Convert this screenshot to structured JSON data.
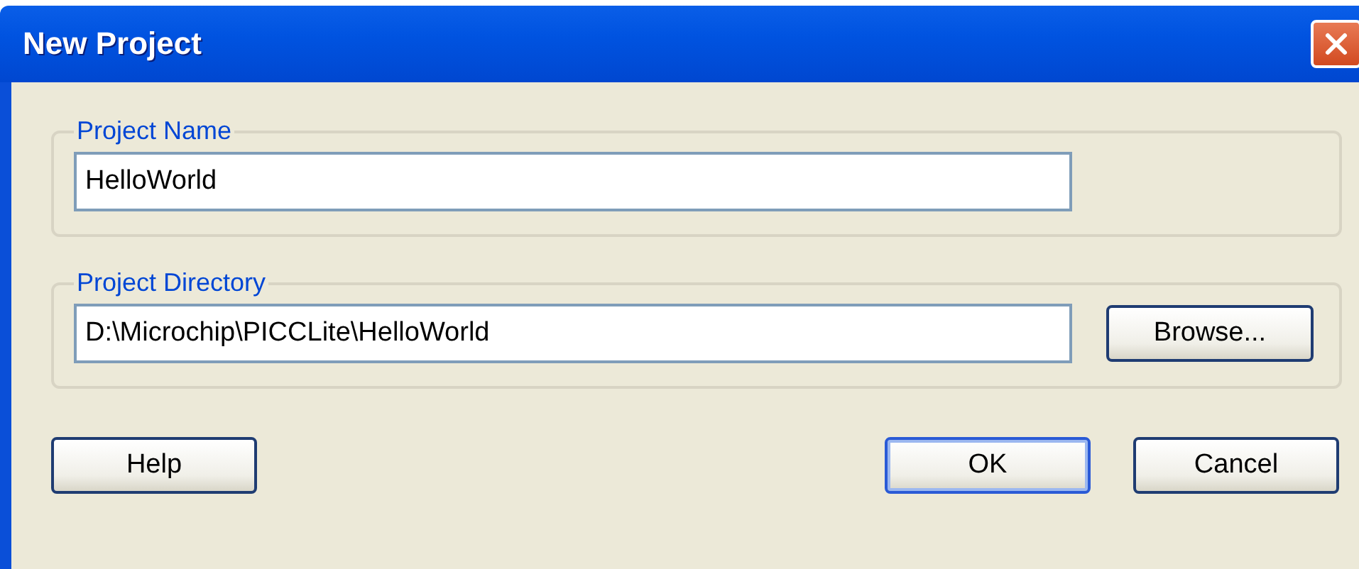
{
  "window": {
    "title": "New Project"
  },
  "groups": [
    {
      "legend": "Project Name",
      "value": "HelloWorld"
    },
    {
      "legend": "Project Directory",
      "value": "D:\\Microchip\\PICCLite\\HelloWorld",
      "button": "Browse..."
    }
  ],
  "buttons": [
    {
      "label": "Help",
      "default": false
    },
    {
      "label": "OK",
      "default": true
    },
    {
      "label": "Cancel",
      "default": false
    }
  ]
}
